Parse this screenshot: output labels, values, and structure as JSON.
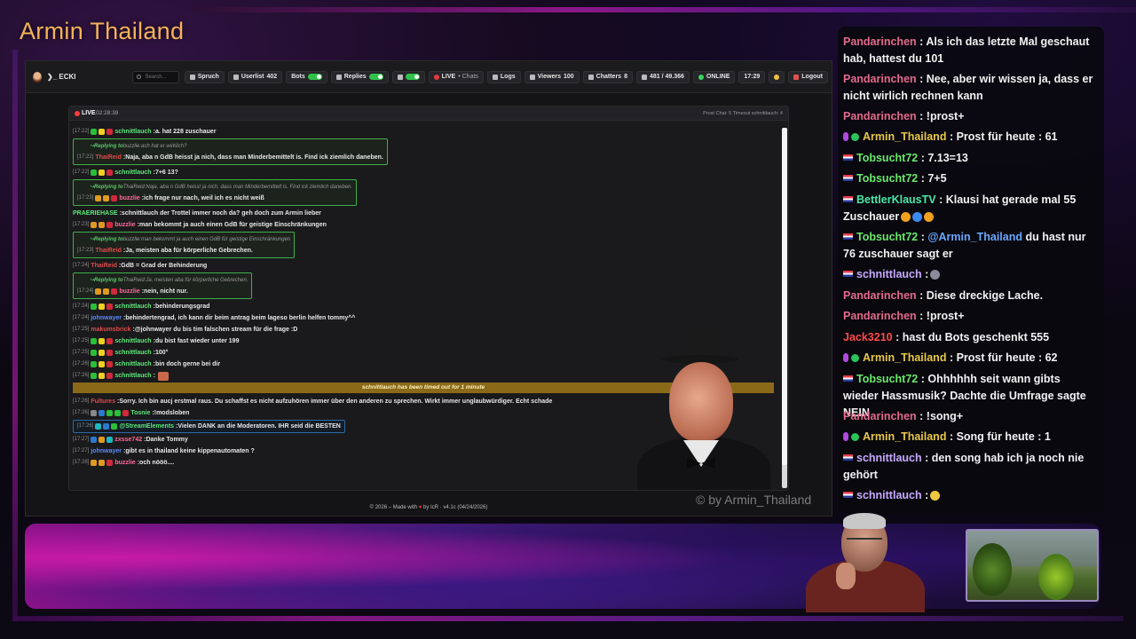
{
  "overlay": {
    "channel_title": "Armin Thailand",
    "watermark": "© by Armin_Thailand"
  },
  "app": {
    "brand": "ECKI",
    "search_placeholder": "Search...",
    "nav": {
      "spruch": "Spruch",
      "userlist_label": "Userlist",
      "userlist_count": "402",
      "bots": "Bots",
      "replies": "Replies",
      "live_label": "LIVE",
      "live_sub": "• Chats",
      "logs": "Logs",
      "viewers_label": "Viewers",
      "viewers_count": "100",
      "chatters_label": "Chatters",
      "chatters_count": "8",
      "messages_count": "481 / 49.366",
      "online": "ONLINE",
      "clock": "17:29",
      "logout": "Logout"
    },
    "chat_head": {
      "live": "LIVE",
      "time": "02:28:39",
      "stats": "Prost Chat: 5  Timeout schnittlauch: 4"
    },
    "messages": [
      {
        "ts": "[17:22]",
        "user": "schnittlauch",
        "text": "a. hat 228 zuschauer"
      },
      {
        "reply_head_prefix": "Replying to",
        "reply_head_user": "buzzlie:",
        "reply_head_text": "ach hat er wirklich?",
        "ts": "[17:22]",
        "user": "ThaiReid",
        "text": "Naja, aba n GdB heisst ja nich, dass man Minderbemittelt is. Find ick ziemlich daneben."
      },
      {
        "ts": "[17:22]",
        "user": "schnittlauch",
        "text": "7+6 13?"
      },
      {
        "reply_head_prefix": "Replying to",
        "reply_head_user": "ThaiReid:",
        "reply_head_text": "Naja, aba n GdB heisst ja nich, dass man Minderbemittelt is. Find ick ziemlich daneben.",
        "ts": "[17:23]",
        "user": "buzzlie",
        "text": "ich frage nur nach, weil ich es nicht weiß"
      },
      {
        "ts": "",
        "user": "PRAERIEHASE",
        "text": "schnittlauch der Trottel immer noch da? geh doch zum Armin lieber"
      },
      {
        "ts": "[17:23]",
        "user": "buzzlie",
        "text": "man bekommt ja auch einen GdB für geistige Einschränkungen"
      },
      {
        "reply_head_prefix": "Replying to",
        "reply_head_user": "buzzlie:",
        "reply_head_text": "man bekommt ja auch einen GdB für geistige Einschränkungen",
        "ts": "[17:23]",
        "user": "ThaiReid",
        "text": "Ja, meisten aba für körperliche Gebrechen."
      },
      {
        "ts": "[17:24]",
        "user": "ThaiReid",
        "text": "GdB = Grad der Behinderung"
      },
      {
        "reply_head_prefix": "Replying to",
        "reply_head_user": "ThaiReid:",
        "reply_head_text": "Ja, meisten aba für körperliche Gebrechen.",
        "ts": "[17:24]",
        "user": "buzzlie",
        "text": "nein, nicht nur."
      },
      {
        "ts": "[17:24]",
        "user": "schnittlauch",
        "text": "behinderungsgrad"
      },
      {
        "ts": "[17:24]",
        "user": "johnwayer",
        "text": "behindertengrad, ich kann dir beim antrag beim lageso berlin helfen tommy^^"
      },
      {
        "ts": "[17:25]",
        "user": "makumsbrick",
        "text": "@johnwayer du bis tim falschen stream für die frage :D"
      },
      {
        "ts": "[17:25]",
        "user": "schnittlauch",
        "text": "du bist fast wieder unter 199"
      },
      {
        "ts": "[17:25]",
        "user": "schnittlauch",
        "text": "100°"
      },
      {
        "ts": "[17:26]",
        "user": "schnittlauch",
        "text": "bin doch gerne bei dir"
      },
      {
        "ts": "[17:26]",
        "user": "schnittlauch",
        "text": ""
      },
      {
        "timeout": "schnittlauch has been timed out for 1 minute"
      },
      {
        "ts": "[17:26]",
        "user": "Fultures",
        "text": "Sorry. Ich bin aucj erstmal raus. Du schaffst es nicht aufzuhören immer über den anderen zu sprechen. Wirkt immer unglaubwürdiger. Echt schade"
      },
      {
        "ts": "[17:26]",
        "user": "Tosnie",
        "text": "!modsloben"
      },
      {
        "ts": "[17:26]",
        "user": "@StreamElements",
        "text": "Vielen DANK an die Moderatoren. IHR seid die BESTEN"
      },
      {
        "ts": "[17:27]",
        "user": "zxsse742",
        "text": "Danke Tommy"
      },
      {
        "ts": "[17:27]",
        "user": "johnwayer",
        "text": "gibt es in thailand keine kippenautomaten ?"
      },
      {
        "ts": "[17:28]",
        "user": "buzzlie",
        "text": "och nööö...."
      }
    ],
    "footer": {
      "left": "© 2026 – Made with",
      "heart": "♥",
      "right": "by IcR · v4.1c (04/24/2026)"
    }
  },
  "stream_chat": [
    {
      "user": "Pandarinchen",
      "text": ": Als ich das letzte Mal geschaut hab, hattest du 101"
    },
    {
      "user": "Pandarinchen",
      "text": ": Nee, aber wir wissen ja, dass er nicht wirlich rechnen kann"
    },
    {
      "user": "Pandarinchen",
      "text": ": !prost+"
    },
    {
      "user": "Armin_Thailand",
      "text": ": Prost für heute : 61"
    },
    {
      "user": "Tobsucht72",
      "text": ": 7.13=13"
    },
    {
      "user": "Tobsucht72",
      "text": ": 7+5"
    },
    {
      "user": "BettlerKlausTV",
      "text": ": Klausi hat gerade mal 55 Zuschauer"
    },
    {
      "user": "Tobsucht72",
      "text": ": ",
      "mention": "@Armin_Thailand",
      "text2": " du hast nur 76 zuschauer sagt er"
    },
    {
      "user": "schnittlauch",
      "text": ":"
    },
    {
      "user": "Pandarinchen",
      "text": ": Diese dreckige Lache."
    },
    {
      "user": "Pandarinchen",
      "text": ": !prost+"
    },
    {
      "user": "Jack3210",
      "text": ": hast du Bots geschenkt 555"
    },
    {
      "user": "Armin_Thailand",
      "text": ": Prost für heute : 62"
    },
    {
      "user": "Tobsucht72",
      "text": ": Ohhhhhh seit wann gibts wieder Hassmusik? Dachte die Umfrage sagte NEIN"
    },
    {
      "user": "Pandarinchen",
      "text": ": !song+"
    },
    {
      "user": "Armin_Thailand",
      "text": ": Song für heute : 1"
    },
    {
      "user": "schnittlauch",
      "text": ": den song hab ich ja noch nie gehört"
    },
    {
      "user": "schnittlauch",
      "text": ":"
    }
  ],
  "colors": {
    "pandarinchen": "#e46a8c",
    "armin": "#e8c84a",
    "tobsucht": "#6ae86a",
    "bettler": "#4ae8a8",
    "schnittlauch": "#c8a8ff",
    "jack": "#ff4a4a",
    "thaireid": "#e04a4a",
    "buzzlie": "#ff6a9a",
    "johnwayer": "#5a8aff",
    "green_user": "#5ee87a"
  }
}
